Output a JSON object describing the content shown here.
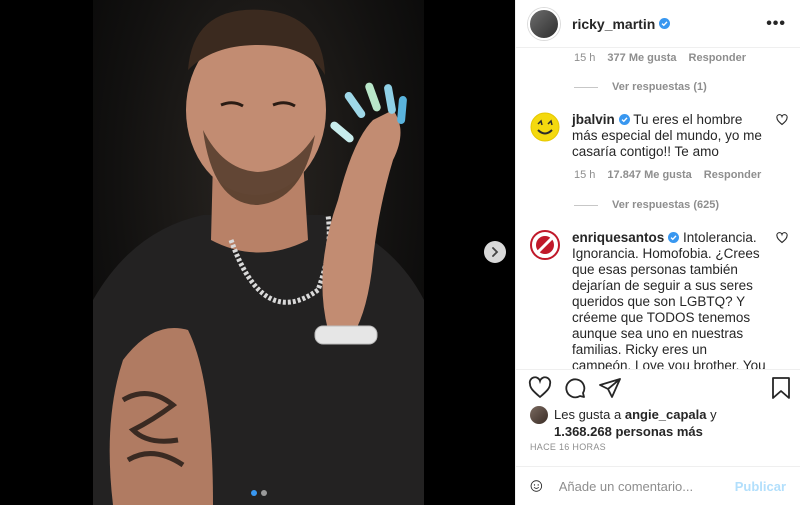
{
  "post": {
    "author": "ricky_martin",
    "more_icon": "more-horizontal-icon",
    "image_alt": "",
    "carousel": {
      "current": 1,
      "total": 2
    }
  },
  "comments": {
    "prev_reply": {
      "time": "15 h",
      "likes": "377 Me gusta",
      "reply": "Responder",
      "view_replies": "Ver respuestas (1)"
    },
    "items": [
      {
        "user": "jbalvin",
        "text": "Tu eres el hombre más especial del mundo, yo me casaría contigo!! Te amo",
        "time": "15 h",
        "likes": "17.847 Me gusta",
        "reply": "Responder",
        "view_replies": "Ver respuestas (625)"
      },
      {
        "user": "enriquesantos",
        "text": "Intolerancia. Ignorancia. Homofobia. ¿Crees que esas personas también dejarían de seguir a sus seres queridos que son LGBTQ? Y créeme que TODOS tenemos aunque sea uno en nuestras familias. Ricky eres un campeón. Love you brother. You make the"
      }
    ]
  },
  "likes": {
    "prefix": "Les gusta a",
    "user": "angie_capala",
    "connector": "y",
    "count": "1.368.268 personas más"
  },
  "timestamp": "HACE 16 HORAS",
  "add_comment": {
    "placeholder": "Añade un comentario...",
    "publish": "Publicar"
  },
  "colors": {
    "verified": "#3897f0",
    "publish_disabled": "#b2dffc",
    "secondary_text": "#8e8e8e"
  }
}
